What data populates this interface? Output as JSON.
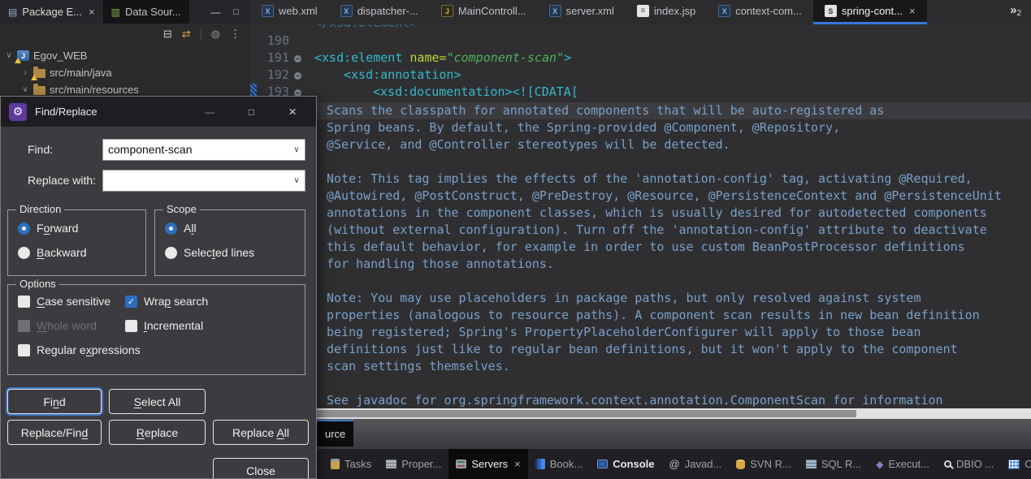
{
  "colors": {
    "accent_blue": "#3a76d8",
    "selection_blue": "#2b6fbe",
    "tag_teal": "#35b9c9",
    "attr_green": "#bfd436",
    "value_green": "#4db056",
    "doc_text_blue": "#7aa0c8",
    "editor_bg": "#2f2f32",
    "dialog_bg": "#3c3c40"
  },
  "icons": {
    "package_explorer": "▤",
    "data_source": "▥",
    "collapse_all": "⊟",
    "link_with_editor": "⇄",
    "focus": "◍",
    "view_menu": "⋮",
    "minimize": "—",
    "maximize": "□",
    "close": "×",
    "chevron_expanded": "∨",
    "chevron_collapsed": "›",
    "combo_chevron": "∨",
    "gear": "⚙",
    "javadoc": "@",
    "execution": "◆",
    "tab_overflow_mark": "»",
    "tab_overflow_count": "2",
    "project_letter": "J"
  },
  "left_panel": {
    "tabs": [
      {
        "label": "Package E..."
      },
      {
        "label": "Data Sour..."
      }
    ],
    "tree": [
      {
        "label": "Egov_WEB"
      },
      {
        "label": "src/main/java"
      },
      {
        "label": "src/main/resources"
      }
    ]
  },
  "editor": {
    "tabs": [
      {
        "label": "web.xml",
        "icon_letter": "X",
        "kind": "xml"
      },
      {
        "label": "dispatcher-...",
        "icon_letter": "X",
        "kind": "xml"
      },
      {
        "label": "MainControll...",
        "icon_letter": "J",
        "kind": "java"
      },
      {
        "label": "server.xml",
        "icon_letter": "X",
        "kind": "xml"
      },
      {
        "label": "index.jsp",
        "icon_letter": "≡",
        "kind": "jsp"
      },
      {
        "label": "context-com...",
        "icon_letter": "X",
        "kind": "xml"
      },
      {
        "label": "spring-cont...",
        "icon_letter": "S",
        "kind": "spring",
        "active": true
      }
    ],
    "partial_top_line": "</xsd:element>",
    "gutter": [
      "190",
      "191",
      "192",
      "193"
    ],
    "code": {
      "l191": {
        "open": "<xsd:element",
        "attr": " name=",
        "value": "\"component-scan\"",
        "close": ">"
      },
      "l192": {
        "open": "<xsd:annotation>"
      },
      "l193": {
        "open": "<xsd:documentation>",
        "cdata": "<![CDATA["
      }
    },
    "doc_lines": [
      "Scans the classpath for annotated components that will be auto-registered as",
      "Spring beans. By default, the Spring-provided @Component, @Repository,",
      "@Service, and @Controller stereotypes will be detected.",
      "",
      "Note: This tag implies the effects of the 'annotation-config' tag, activating @Required,",
      "@Autowired, @PostConstruct, @PreDestroy, @Resource, @PersistenceContext and @PersistenceUnit",
      "annotations in the component classes, which is usually desired for autodetected components",
      "(without external configuration). Turn off the 'annotation-config' attribute to deactivate",
      "this default behavior, for example in order to use custom BeanPostProcessor definitions",
      "for handling those annotations.",
      "",
      "Note: You may use placeholders in package paths, but only resolved against system",
      "properties (analogous to resource paths). A component scan results in new bean definition",
      "being registered; Spring's PropertyPlaceholderConfigurer will apply to those bean",
      "definitions just like to regular bean definitions, but it won't apply to the component",
      "scan settings themselves.",
      "",
      "See javadoc for org.springframework.context.annotation.ComponentScan for information"
    ],
    "bottom_tab": "urce"
  },
  "dialog": {
    "title": "Find/Replace",
    "find_label": "Find:",
    "find_value": "component-scan",
    "replace_label": "Replace with:",
    "replace_value": "",
    "groups": {
      "direction": {
        "title": "Direction",
        "options": [
          {
            "pre": "F",
            "u": "o",
            "post": "rward",
            "selected": true
          },
          {
            "pre": "",
            "u": "B",
            "post": "ackward",
            "selected": false
          }
        ]
      },
      "scope": {
        "title": "Scope",
        "options": [
          {
            "pre": "A",
            "u": "l",
            "post": "l",
            "selected": true
          },
          {
            "pre": "Selec",
            "u": "t",
            "post": "ed lines",
            "selected": false
          }
        ]
      },
      "options": {
        "title": "Options",
        "checkboxes": [
          {
            "pre": "",
            "u": "C",
            "post": "ase sensitive",
            "checked": false,
            "disabled": false
          },
          {
            "pre": "Wra",
            "u": "p",
            "post": " search",
            "checked": true,
            "disabled": false
          },
          {
            "pre": "",
            "u": "W",
            "post": "hole word",
            "checked": false,
            "disabled": true
          },
          {
            "pre": "",
            "u": "I",
            "post": "ncremental",
            "checked": false,
            "disabled": false
          },
          {
            "pre": "Regular e",
            "u": "x",
            "post": "pressions",
            "checked": false,
            "disabled": false
          }
        ]
      }
    },
    "buttons": {
      "find": {
        "pre": "Fi",
        "u": "n",
        "post": "d"
      },
      "select_all": {
        "pre": "",
        "u": "S",
        "post": "elect All"
      },
      "replace_find": {
        "pre": "Replace/Fin",
        "u": "d",
        "post": ""
      },
      "replace": {
        "pre": "",
        "u": "R",
        "post": "eplace"
      },
      "replace_all": {
        "pre": "Replace ",
        "u": "A",
        "post": "ll"
      },
      "close": {
        "pre": "Close",
        "u": "",
        "post": ""
      }
    }
  },
  "bottom_panel": {
    "tabs": [
      {
        "icon": "tasks-icon",
        "label": "Tasks"
      },
      {
        "icon": "properties-icon",
        "label": "Proper..."
      },
      {
        "icon": "servers-icon",
        "label": "Servers",
        "active": true
      },
      {
        "icon": "bookmarks-icon",
        "label": "Book..."
      },
      {
        "icon": "console-icon",
        "label": "Console",
        "bold": true
      },
      {
        "icon": "javadoc-icon",
        "label": "Javad..."
      },
      {
        "icon": "svn-repo-icon",
        "label": "SVN R..."
      },
      {
        "icon": "sql-results-icon",
        "label": "SQL R..."
      },
      {
        "icon": "execution-icon",
        "label": "Execut..."
      },
      {
        "icon": "dbio-icon",
        "label": "DBIO ..."
      },
      {
        "icon": "table-icon",
        "label": "C"
      }
    ]
  }
}
